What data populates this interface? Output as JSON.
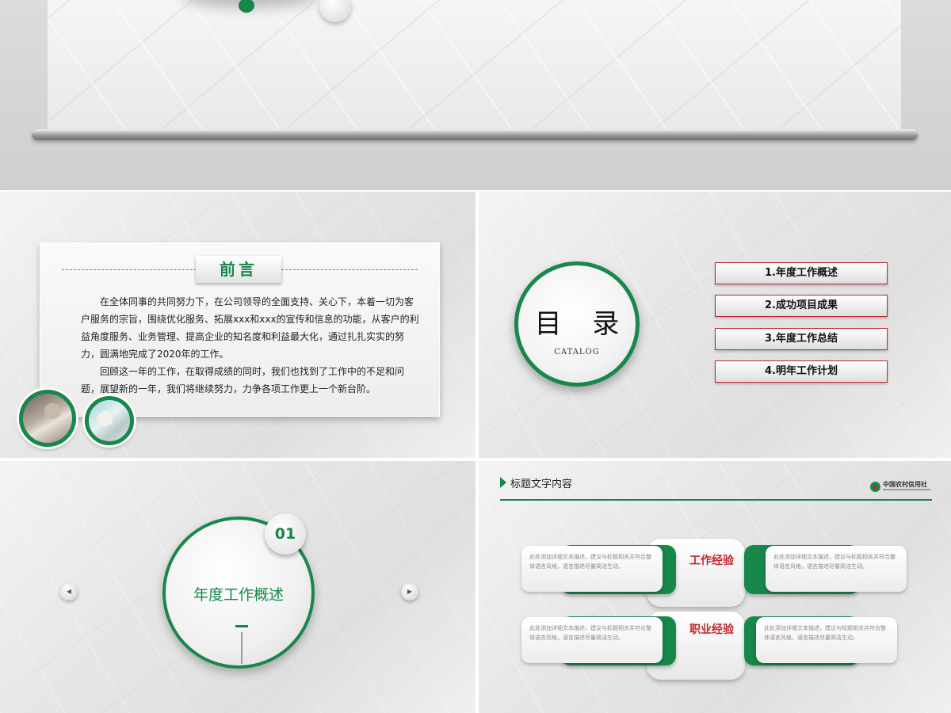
{
  "preface": {
    "title": "前言",
    "paragraph1": "在全体同事的共同努力下，在公司领导的全面支持、关心下，本着一切为客户服务的宗旨，围绕优化服务、拓展xxx和xxx的宣传和信息的功能，从客户的利益角度服务、业务管理、提高企业的知名度和利益最大化，通过扎扎实实的努力，圆满地完成了2020年的工作。",
    "paragraph2": "回顾这一年的工作，在取得成绩的同时，我们也找到了工作中的不足和问题，展望新的一年，我们将继续努力，力争各项工作更上一个新台阶。"
  },
  "catalog": {
    "title": "目 录",
    "subtitle": "CATALOG",
    "items": [
      "1.年度工作概述",
      "2.成功项目成果",
      "3.年度工作总结",
      "4.明年工作计划"
    ]
  },
  "section": {
    "number": "01",
    "title": "年度工作概述",
    "prev_icon": "◀",
    "next_icon": "▶"
  },
  "content": {
    "header_title": "标题文字内容",
    "logo_text": "中国农村信用社",
    "label_top": "工作经验",
    "label_bottom": "职业经验",
    "cards": [
      "此处添加详细文本描述，建议与标题相关并符合整体语言风格，语言描述尽量简洁生动。",
      "此处添加详细文本描述，建议与标题相关并符合整体语言风格，语言描述尽量简洁生动。",
      "此处添加详细文本描述，建议与标题相关并符合整体语言风格，语言描述尽量简洁生动。",
      "此处添加详细文本描述，建议与标题相关并符合整体语言风格，语言描述尽量简洁生动。"
    ]
  },
  "colors": {
    "green": "#17874a",
    "red": "#c0272d"
  }
}
